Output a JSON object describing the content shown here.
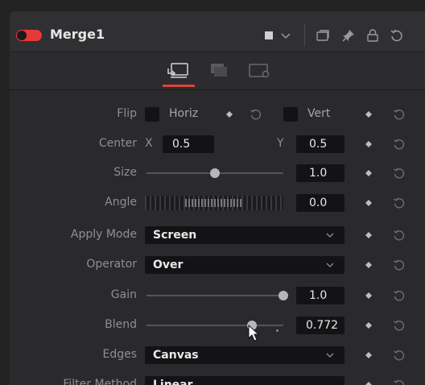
{
  "header": {
    "title": "Merge1",
    "toggle_color": "#e8393a"
  },
  "tabs": [
    {
      "name": "tools-tab",
      "active": true
    },
    {
      "name": "channels-tab",
      "active": false
    },
    {
      "name": "settings-tab",
      "active": false
    }
  ],
  "controls": {
    "flip": {
      "label": "Flip",
      "horiz_label": "Horiz",
      "vert_label": "Vert"
    },
    "center": {
      "label": "Center",
      "x_label": "X",
      "x_value": "0.5",
      "y_label": "Y",
      "y_value": "0.5"
    },
    "size": {
      "label": "Size",
      "value": "1.0",
      "level": 0.5
    },
    "angle": {
      "label": "Angle",
      "value": "0.0"
    },
    "apply_mode": {
      "label": "Apply Mode",
      "value": "Screen"
    },
    "operator": {
      "label": "Operator",
      "value": "Over"
    },
    "gain": {
      "label": "Gain",
      "value": "1.0",
      "level": 1.0
    },
    "blend": {
      "label": "Blend",
      "value": "0.772",
      "level": 0.772
    },
    "edges": {
      "label": "Edges",
      "value": "Canvas"
    },
    "filter_method": {
      "label": "Filter Method",
      "value": "Linear"
    }
  },
  "accent_color": "#e0433a"
}
